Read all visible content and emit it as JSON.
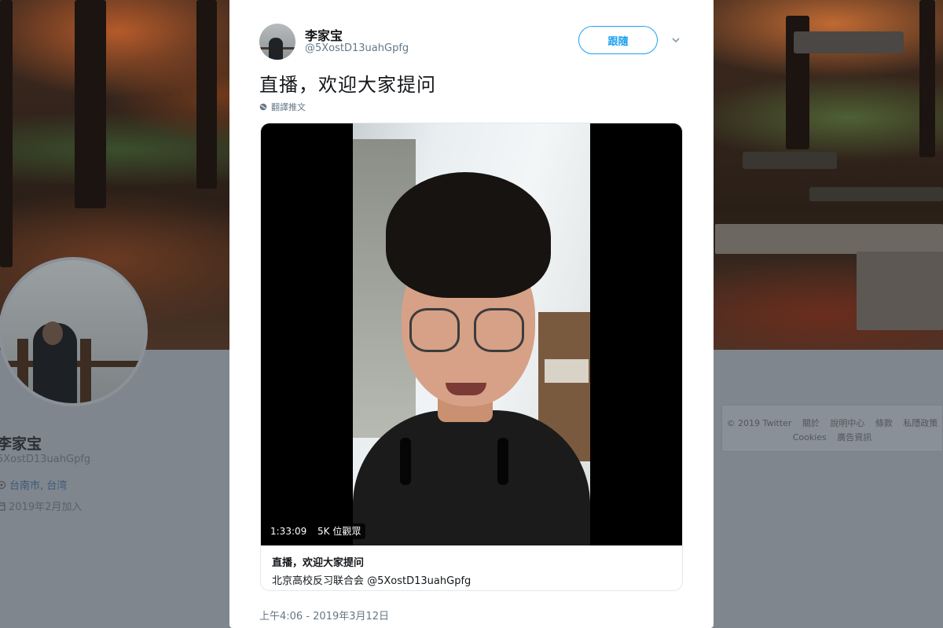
{
  "background_profile": {
    "name": "李家宝",
    "handle": "5XostD13uahGpfg",
    "location": "台南市, 台湾",
    "joined": "2019年2月加入",
    "footer_row1": [
      "© 2019 Twitter",
      "關於",
      "說明中心",
      "條款",
      "私隱政策"
    ],
    "footer_row2": [
      "Cookies",
      "廣告資訊"
    ]
  },
  "tweet": {
    "display_name": "李家宝",
    "handle": "@5XostD13uahGpfg",
    "follow_label": "跟隨",
    "text": "直播，欢迎大家提问",
    "translate_label": "翻譯推文",
    "video_duration": "1:33:09",
    "video_views": "5K 位觀眾",
    "card_title": "直播，欢迎大家提问",
    "card_source": "北京高校反习联合会 @5XostD13uahGpfg",
    "timestamp": "上午4:06 - 2019年3月12日"
  },
  "colors": {
    "accent": "#1da1f2",
    "secondary_text": "#657786",
    "overlay_bg": "#7f868d"
  },
  "icons": {
    "translate": "globe-icon",
    "caret": "chevron-down-icon",
    "location": "location-pin-icon",
    "joined": "calendar-icon"
  }
}
